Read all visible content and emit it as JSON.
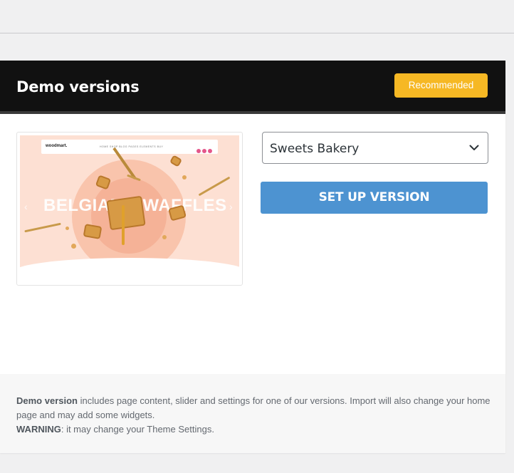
{
  "panel": {
    "title": "Demo versions",
    "badge": "Recommended"
  },
  "preview": {
    "logo": "woodmart.",
    "nav_links": "HOME  SHOP  BLOG  PAGES  ELEMENTS  BUY",
    "login_text": "LOGIN / REGISTER",
    "hero_word_1": "BELGIAN",
    "hero_word_2": "WAFFLES",
    "colors": {
      "background": "#fde0d3",
      "circle": "#f9c4ac",
      "accent": "#e4568a"
    }
  },
  "demo_select": {
    "value": "Sweets Bakery",
    "icon": "chevron-down-icon"
  },
  "setup_button": {
    "label": "SET UP VERSION",
    "color": "#4d93d1"
  },
  "footer": {
    "strong_1": "Demo version",
    "text_1": " includes page content, slider and settings for one of our versions. Import will also change your home page and may add some widgets.",
    "strong_2": "WARNING",
    "text_2": ": it may change your Theme Settings."
  },
  "colors": {
    "header_bg": "#111111",
    "badge_bg": "#f6b824"
  }
}
